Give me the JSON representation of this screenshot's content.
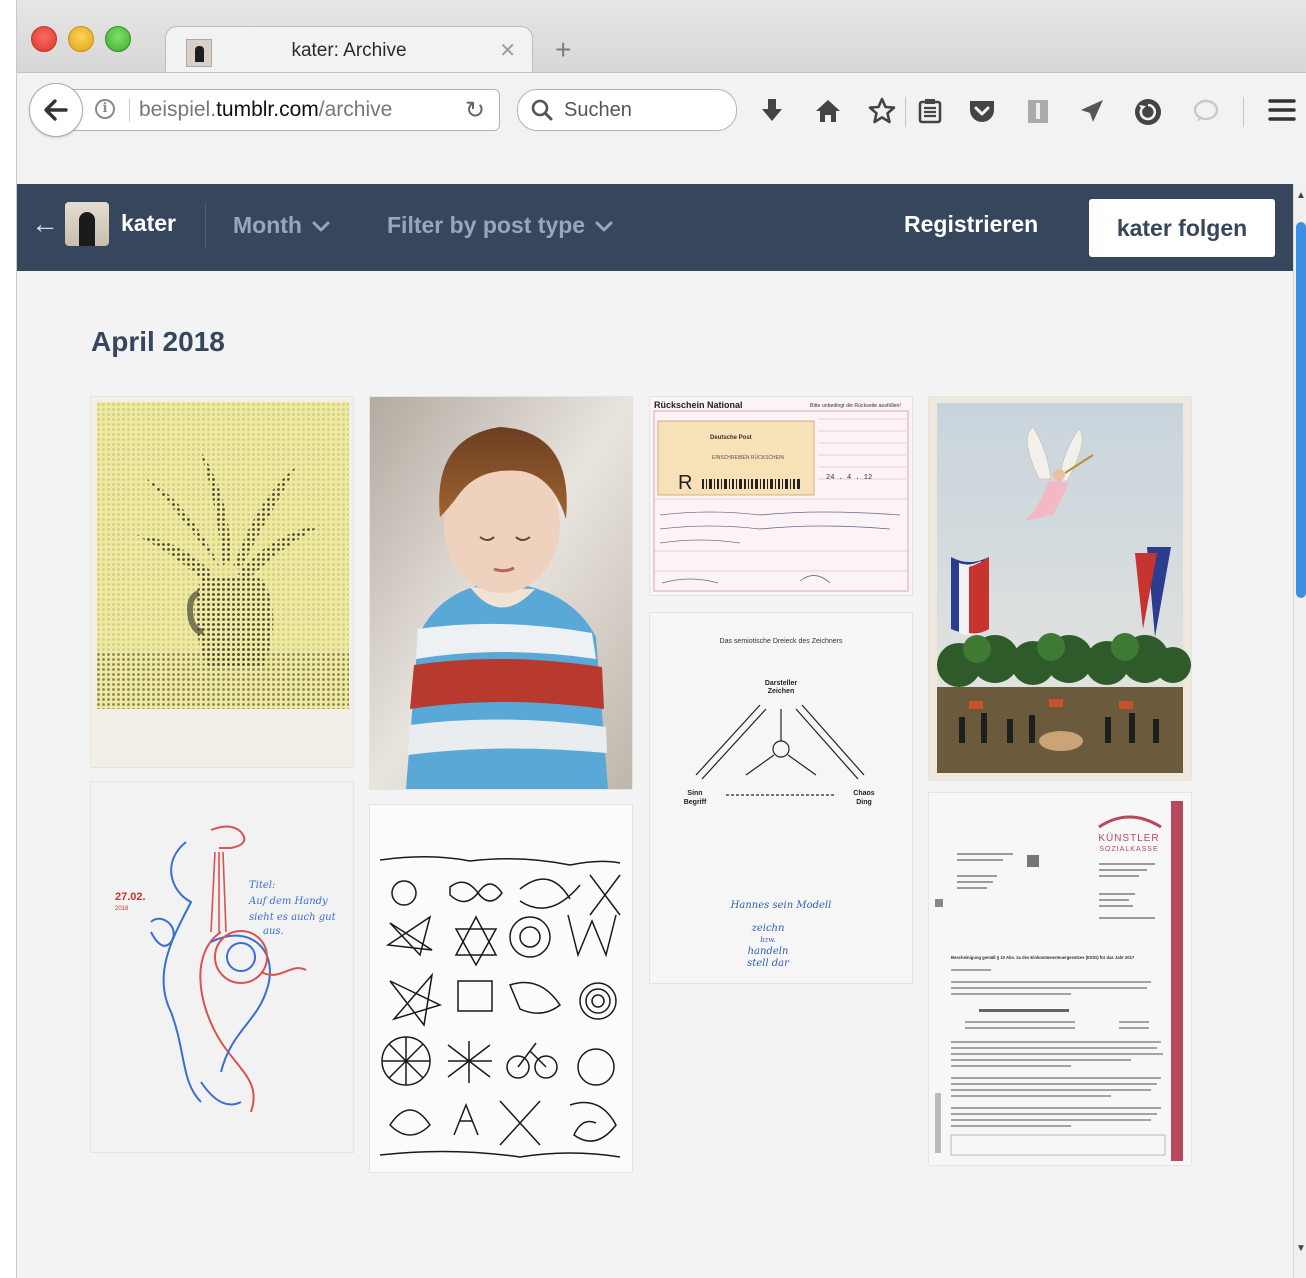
{
  "browser": {
    "tab_title": "kater: Archive",
    "url_prefix": "beispiel.",
    "url_domain": "tumblr.com",
    "url_path": "/archive",
    "search_placeholder": "Suchen"
  },
  "header": {
    "blog_name": "kater",
    "month_filter": "Month",
    "post_type_filter": "Filter by post type",
    "register": "Registrieren",
    "follow": "kater folgen"
  },
  "archive": {
    "month_heading": "April 2018",
    "posts": [
      {
        "name": "post-vase-halftone"
      },
      {
        "name": "post-child-striped-shirt"
      },
      {
        "name": "post-rueckschein",
        "title": "Rückschein National",
        "note": "Bitte unbedingt die Rückseite ausfüllen!",
        "sender": "Deutsche Post",
        "stamp": "EINSCHREIBEN RÜCKSCHEIN",
        "letter": "R",
        "date": "24 . 4 . 12"
      },
      {
        "name": "post-naive-painting"
      },
      {
        "name": "post-blue-red-drawing",
        "date": "27.02.",
        "year": "2018",
        "caption": [
          "Titel:",
          "Auf dem Handy",
          "sieht es auch gut",
          "aus."
        ]
      },
      {
        "name": "post-sketch-page"
      },
      {
        "name": "post-semiotic-triangle",
        "title": "Das semiotische Dreieck des Zeichners",
        "top": "Darsteller",
        "top2": "Zeichen",
        "left": "Sinn",
        "left2": "Begriff",
        "right": "Chaos",
        "right2": "Ding",
        "handwritten": [
          "Hannes sein Modell",
          "zeichn",
          "bzw.",
          "handeln",
          "stell dar"
        ]
      },
      {
        "name": "post-ksk-letter",
        "logo_line1": "KÜNSTLER",
        "logo_line2": "SOZIALKASSE",
        "heading": "Bescheinigung gemäß § 10 Abs. 2a des Einkommensteuergesetzes (EStG) für das Jahr 2017"
      }
    ]
  },
  "colors": {
    "tumblr_navy": "#36465d",
    "page_bg": "#f3f3f4",
    "accent_blue": "#3d8ee6"
  },
  "icons": [
    "back-arrow-icon",
    "info-icon",
    "reload-icon",
    "search-icon",
    "download-icon",
    "home-icon",
    "bookmark-star-icon",
    "reading-list-icon",
    "pocket-icon",
    "library-icon",
    "send-icon",
    "sync-icon",
    "chat-icon",
    "menu-icon"
  ]
}
